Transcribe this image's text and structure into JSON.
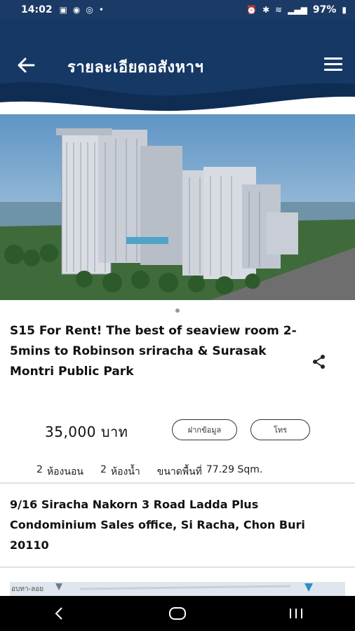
{
  "status_bar": {
    "time": "14:02",
    "battery": "97%"
  },
  "header": {
    "title": "รายละเอียดอสังหาฯ",
    "colors": {
      "bg": "#163865",
      "wave": "#0f2c53",
      "light": "#ffffff"
    }
  },
  "listing": {
    "title": "S15 For Rent! The best of seaview room 2-5mins to Robinson sriracha & Surasak Montri Public Park",
    "price": "35,000 บาท",
    "contact_button": "ฝากข้อมูล",
    "call_button": "โทร",
    "bedrooms_count": "2",
    "bedrooms_label": "ห้องนอน",
    "bathrooms_count": "2",
    "bathrooms_label": "ห้องน้ำ",
    "area_label": "ขนาดพื้นที่",
    "area_value": "77.29 Sqm."
  },
  "address": "9/16 Siracha Nakorn 3 Road Ladda Plus Condominium Sales office, Si Racha, Chon Buri 20110",
  "map": {
    "label": "อบทา-ลอย"
  }
}
